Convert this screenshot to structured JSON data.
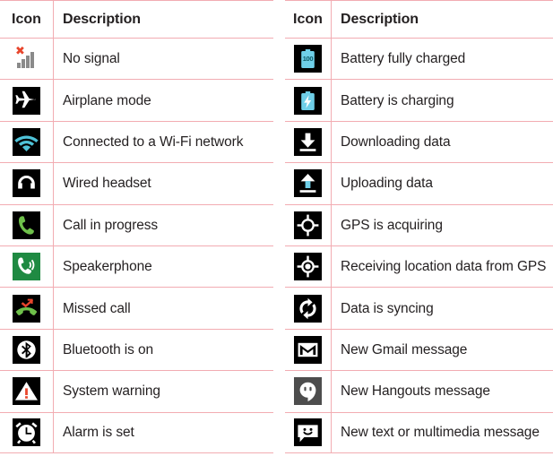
{
  "table_left": {
    "headers": {
      "icon": "Icon",
      "description": "Description"
    },
    "rows": [
      {
        "icon_name": "no-signal-icon",
        "description": "No signal"
      },
      {
        "icon_name": "airplane-mode-icon",
        "description": "Airplane mode"
      },
      {
        "icon_name": "wifi-connected-icon",
        "description": "Connected to a Wi-Fi network"
      },
      {
        "icon_name": "wired-headset-icon",
        "description": "Wired headset"
      },
      {
        "icon_name": "call-in-progress-icon",
        "description": "Call in progress"
      },
      {
        "icon_name": "speakerphone-icon",
        "description": "Speakerphone"
      },
      {
        "icon_name": "missed-call-icon",
        "description": "Missed call"
      },
      {
        "icon_name": "bluetooth-on-icon",
        "description": "Bluetooth is on"
      },
      {
        "icon_name": "system-warning-icon",
        "description": "System warning"
      },
      {
        "icon_name": "alarm-set-icon",
        "description": "Alarm is set"
      }
    ]
  },
  "table_right": {
    "headers": {
      "icon": "Icon",
      "description": "Description"
    },
    "rows": [
      {
        "icon_name": "battery-full-icon",
        "description": "Battery fully charged",
        "badge": "100"
      },
      {
        "icon_name": "battery-charging-icon",
        "description": "Battery is charging"
      },
      {
        "icon_name": "download-icon",
        "description": "Downloading data"
      },
      {
        "icon_name": "upload-icon",
        "description": "Uploading data"
      },
      {
        "icon_name": "gps-acquiring-icon",
        "description": "GPS is acquiring"
      },
      {
        "icon_name": "gps-fixed-icon",
        "description": "Receiving location data from GPS"
      },
      {
        "icon_name": "sync-icon",
        "description": "Data is syncing"
      },
      {
        "icon_name": "gmail-icon",
        "description": "New Gmail message"
      },
      {
        "icon_name": "hangouts-icon",
        "description": "New Hangouts message"
      },
      {
        "icon_name": "sms-icon",
        "description": "New text or multimedia message"
      }
    ]
  },
  "colors": {
    "rule": "#f2acb2",
    "text": "#231f20",
    "icon_black": "#000000",
    "icon_green": "#1f8a42",
    "icon_gray": "#4d4d4d",
    "accent_blue": "#6fcfe8",
    "accent_red": "#e8452c",
    "bar_gray": "#8a8a8a"
  }
}
